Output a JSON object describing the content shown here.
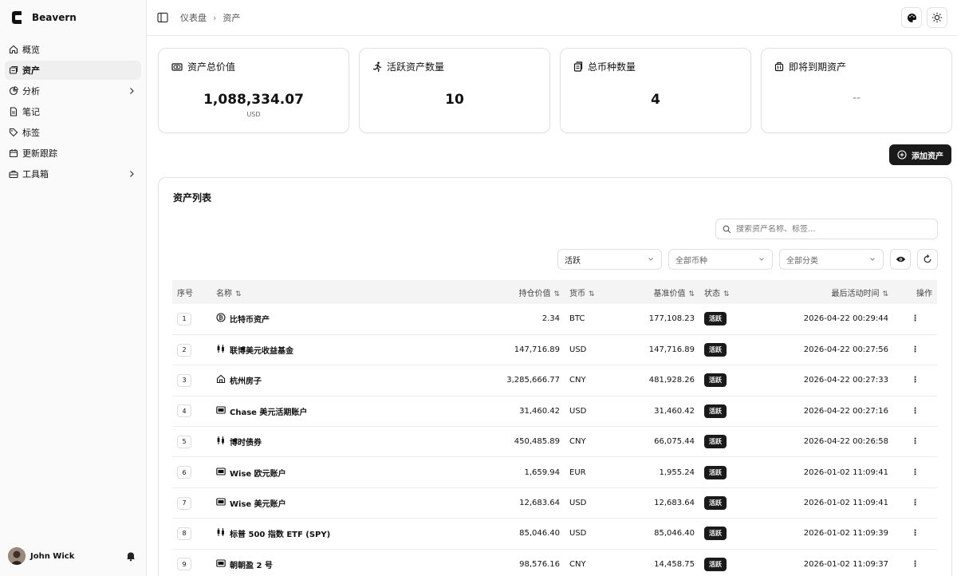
{
  "app": {
    "name": "Beavern"
  },
  "sidebar": {
    "items": [
      {
        "label": "概览",
        "icon": "home-icon"
      },
      {
        "label": "资产",
        "icon": "assets-icon"
      },
      {
        "label": "分析",
        "icon": "pie-chart-icon"
      },
      {
        "label": "笔记",
        "icon": "note-icon"
      },
      {
        "label": "标签",
        "icon": "tag-icon"
      },
      {
        "label": "更新跟踪",
        "icon": "calendar-icon"
      },
      {
        "label": "工具箱",
        "icon": "toolbox-icon"
      }
    ],
    "active": "资产",
    "user": {
      "name": "John Wick"
    }
  },
  "header": {
    "breadcrumbs": [
      "仪表盘",
      "资产"
    ]
  },
  "stats": [
    {
      "label": "资产总价值",
      "value": "1,088,334.07",
      "unit": "USD",
      "icon": "wallet-icon"
    },
    {
      "label": "活跃资产数量",
      "value": "10",
      "unit": "",
      "icon": "running-person-icon"
    },
    {
      "label": "总币种数量",
      "value": "4",
      "unit": "",
      "icon": "currency-stack-icon"
    },
    {
      "label": "即将到期资产",
      "value": "--",
      "unit": "",
      "icon": "luggage-icon"
    }
  ],
  "actions": {
    "add_asset": "添加资产"
  },
  "list": {
    "title": "资产列表",
    "search_placeholder": "搜索资产名称、标签...",
    "filters": {
      "status": "活跃",
      "currency": "全部币种",
      "category": "全部分类"
    },
    "columns": {
      "index": "序号",
      "name": "名称",
      "holding": "持仓价值",
      "currency": "货币",
      "base_value": "基准价值",
      "status": "状态",
      "last_activity": "最后活动时间",
      "actions": "操作"
    },
    "rows": [
      {
        "index": "1",
        "name": "比特币资产",
        "icon": "bitcoin-icon",
        "holding": "2.34",
        "currency": "BTC",
        "base_value": "177,108.23",
        "status": "活跃",
        "last_activity": "2026-04-22 00:29:44"
      },
      {
        "index": "2",
        "name": "联博美元收益基金",
        "icon": "candlestick-icon",
        "holding": "147,716.89",
        "currency": "USD",
        "base_value": "147,716.89",
        "status": "活跃",
        "last_activity": "2026-04-22 00:27:56"
      },
      {
        "index": "3",
        "name": "杭州房子",
        "icon": "house-icon",
        "holding": "3,285,666.77",
        "currency": "CNY",
        "base_value": "481,928.26",
        "status": "活跃",
        "last_activity": "2026-04-22 00:27:33"
      },
      {
        "index": "4",
        "name": "Chase 美元活期账户",
        "icon": "bank-card-icon",
        "holding": "31,460.42",
        "currency": "USD",
        "base_value": "31,460.42",
        "status": "活跃",
        "last_activity": "2026-04-22 00:27:16"
      },
      {
        "index": "5",
        "name": "博时债券",
        "icon": "candlestick-icon",
        "holding": "450,485.89",
        "currency": "CNY",
        "base_value": "66,075.44",
        "status": "活跃",
        "last_activity": "2026-04-22 00:26:58"
      },
      {
        "index": "6",
        "name": "Wise 欧元账户",
        "icon": "bank-card-icon",
        "holding": "1,659.94",
        "currency": "EUR",
        "base_value": "1,955.24",
        "status": "活跃",
        "last_activity": "2026-01-02 11:09:41"
      },
      {
        "index": "7",
        "name": "Wise 美元账户",
        "icon": "bank-card-icon",
        "holding": "12,683.64",
        "currency": "USD",
        "base_value": "12,683.64",
        "status": "活跃",
        "last_activity": "2026-01-02 11:09:41"
      },
      {
        "index": "8",
        "name": "标普 500 指数 ETF (SPY)",
        "icon": "candlestick-icon",
        "holding": "85,046.40",
        "currency": "USD",
        "base_value": "85,046.40",
        "status": "活跃",
        "last_activity": "2026-01-02 11:09:39"
      },
      {
        "index": "9",
        "name": "朝朝盈 2 号",
        "icon": "bank-card-icon",
        "holding": "98,576.16",
        "currency": "CNY",
        "base_value": "14,458.75",
        "status": "活跃",
        "last_activity": "2026-01-02 11:09:37"
      }
    ]
  }
}
